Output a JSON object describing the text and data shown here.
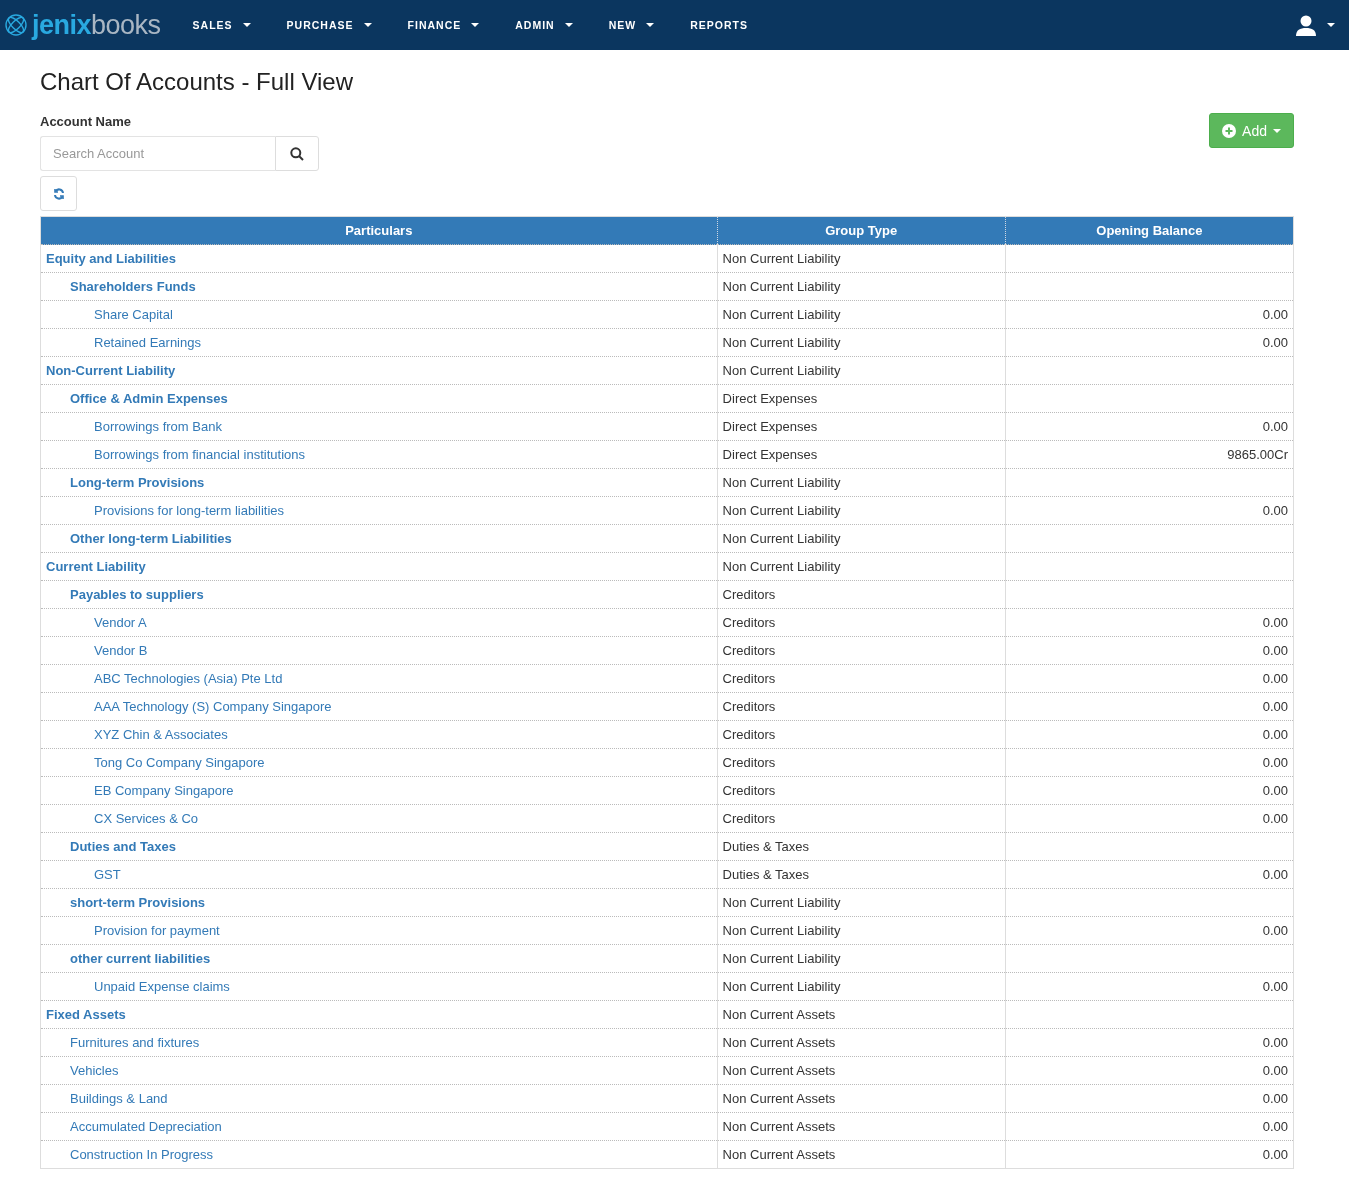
{
  "navbar": {
    "logo": {
      "part1": "jenix",
      "part2": "books"
    },
    "items": [
      {
        "label": "SALES",
        "kind": "dropdown"
      },
      {
        "label": "PURCHASE",
        "kind": "dropdown"
      },
      {
        "label": "FINANCE",
        "kind": "dropdown"
      },
      {
        "label": "ADMIN",
        "kind": "dropdown"
      },
      {
        "label": "NEW",
        "kind": "dropdown"
      },
      {
        "label": "REPORTS",
        "kind": "link"
      }
    ]
  },
  "page": {
    "title": "Chart Of Accounts - Full View",
    "add_button": "Add"
  },
  "search": {
    "label": "Account Name",
    "placeholder": "Search Account"
  },
  "table": {
    "columns": [
      "Particulars",
      "Group Type",
      "Opening Balance"
    ],
    "rows": [
      {
        "name": "Equity and Liabilities",
        "kind": "group",
        "group_type": "Non Current Liability",
        "children": [
          {
            "name": "Shareholders Funds",
            "kind": "group",
            "group_type": "Non Current Liability",
            "children": [
              {
                "name": "Share Capital",
                "kind": "ledger",
                "group_type": "Non Current Liability",
                "opening_balance": "0.00"
              },
              {
                "name": "Retained Earnings",
                "kind": "ledger",
                "group_type": "Non Current Liability",
                "opening_balance": "0.00"
              }
            ]
          }
        ]
      },
      {
        "name": "Non-Current Liability",
        "kind": "group",
        "group_type": "Non Current Liability",
        "children": [
          {
            "name": "Office & Admin Expenses",
            "kind": "group",
            "group_type": "Direct Expenses",
            "children": [
              {
                "name": "Borrowings from Bank",
                "kind": "ledger",
                "group_type": "Direct Expenses",
                "opening_balance": "0.00"
              },
              {
                "name": "Borrowings from financial institutions",
                "kind": "ledger",
                "group_type": "Direct Expenses",
                "opening_balance": "9865.00Cr"
              }
            ]
          },
          {
            "name": "Long-term Provisions",
            "kind": "group",
            "group_type": "Non Current Liability",
            "children": [
              {
                "name": "Provisions for long-term liabilities",
                "kind": "ledger",
                "group_type": "Non Current Liability",
                "opening_balance": "0.00"
              }
            ]
          },
          {
            "name": "Other long-term Liabilities",
            "kind": "group",
            "group_type": "Non Current Liability"
          }
        ]
      },
      {
        "name": "Current Liability",
        "kind": "group",
        "group_type": "Non Current Liability",
        "children": [
          {
            "name": "Payables to suppliers",
            "kind": "group",
            "group_type": "Creditors",
            "children": [
              {
                "name": "Vendor A",
                "kind": "ledger",
                "group_type": "Creditors",
                "opening_balance": "0.00"
              },
              {
                "name": "Vendor B",
                "kind": "ledger",
                "group_type": "Creditors",
                "opening_balance": "0.00"
              },
              {
                "name": "ABC Technologies (Asia) Pte Ltd",
                "kind": "ledger",
                "group_type": "Creditors",
                "opening_balance": "0.00"
              },
              {
                "name": "AAA Technology (S) Company Singapore",
                "kind": "ledger",
                "group_type": "Creditors",
                "opening_balance": "0.00"
              },
              {
                "name": "XYZ Chin & Associates",
                "kind": "ledger",
                "group_type": "Creditors",
                "opening_balance": "0.00"
              },
              {
                "name": "Tong Co Company Singapore",
                "kind": "ledger",
                "group_type": "Creditors",
                "opening_balance": "0.00"
              },
              {
                "name": "EB Company Singapore",
                "kind": "ledger",
                "group_type": "Creditors",
                "opening_balance": "0.00"
              },
              {
                "name": "CX Services & Co",
                "kind": "ledger",
                "group_type": "Creditors",
                "opening_balance": "0.00"
              }
            ]
          },
          {
            "name": "Duties and Taxes",
            "kind": "group",
            "group_type": "Duties & Taxes",
            "children": [
              {
                "name": "GST",
                "kind": "ledger",
                "group_type": "Duties & Taxes",
                "opening_balance": "0.00"
              }
            ]
          },
          {
            "name": "short-term Provisions",
            "kind": "group",
            "group_type": "Non Current Liability",
            "children": [
              {
                "name": "Provision for payment",
                "kind": "ledger",
                "group_type": "Non Current Liability",
                "opening_balance": "0.00"
              }
            ]
          },
          {
            "name": "other current liabilities",
            "kind": "group",
            "group_type": "Non Current Liability",
            "children": [
              {
                "name": "Unpaid Expense claims",
                "kind": "ledger",
                "group_type": "Non Current Liability",
                "opening_balance": "0.00"
              }
            ]
          }
        ]
      },
      {
        "name": "Fixed Assets",
        "kind": "group",
        "group_type": "Non Current Assets",
        "children": [
          {
            "name": "Furnitures and fixtures",
            "kind": "ledger",
            "group_type": "Non Current Assets",
            "opening_balance": "0.00"
          },
          {
            "name": "Vehicles",
            "kind": "ledger",
            "group_type": "Non Current Assets",
            "opening_balance": "0.00"
          },
          {
            "name": "Buildings & Land",
            "kind": "ledger",
            "group_type": "Non Current Assets",
            "opening_balance": "0.00"
          },
          {
            "name": "Accumulated Depreciation",
            "kind": "ledger",
            "group_type": "Non Current Assets",
            "opening_balance": "0.00"
          },
          {
            "name": "Construction In Progress",
            "kind": "ledger",
            "group_type": "Non Current Assets",
            "opening_balance": "0.00"
          }
        ]
      }
    ]
  }
}
